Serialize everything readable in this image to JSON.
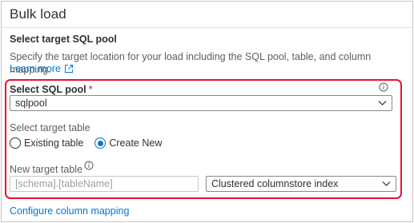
{
  "panel": {
    "title": "Bulk load"
  },
  "target": {
    "heading": "Select target SQL pool",
    "description": "Specify the target location for your load including the SQL pool, table, and column mapping.",
    "learn_more": "Learn more"
  },
  "sql_pool": {
    "label": "Select SQL pool",
    "required_mark": "*",
    "selected": "sqlpool"
  },
  "target_table": {
    "label": "Select target table",
    "options": [
      {
        "label": "Existing table",
        "checked": false
      },
      {
        "label": "Create New",
        "checked": true
      }
    ]
  },
  "new_table": {
    "label": "New target table",
    "placeholder": "[schema].[tableName]",
    "index_type": "Clustered columnstore index"
  },
  "mapping": {
    "link": "Configure column mapping"
  },
  "colors": {
    "accent": "#0078d4",
    "highlight": "#e8112d"
  }
}
